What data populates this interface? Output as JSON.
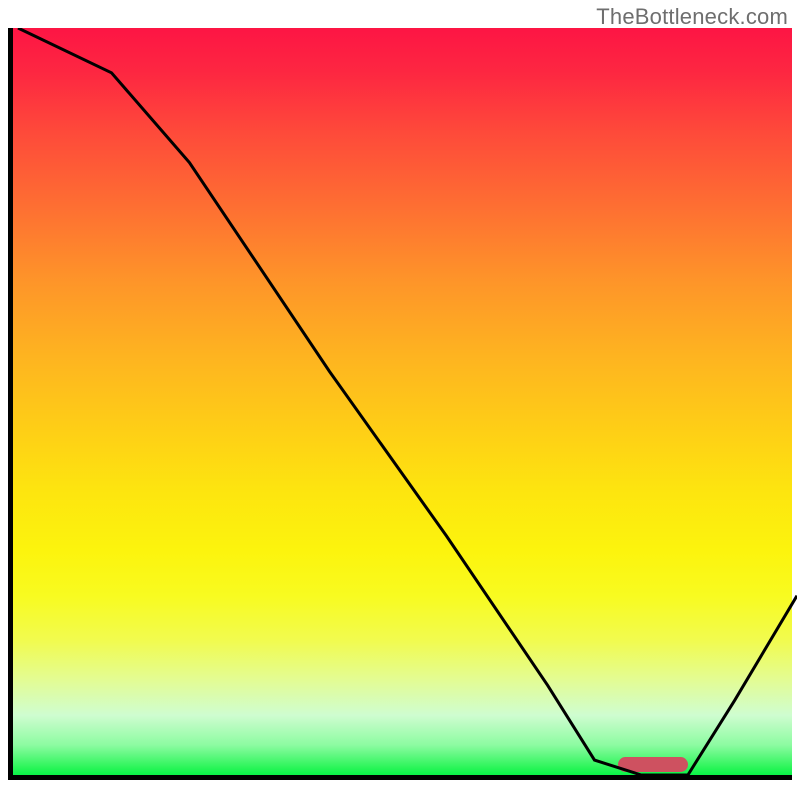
{
  "watermark": "TheBottleneck.com",
  "chart_data": {
    "type": "line",
    "title": "",
    "xlabel": "",
    "ylabel": "",
    "xlim": [
      0,
      100
    ],
    "ylim": [
      0,
      100
    ],
    "background": "traffic-light-gradient",
    "series": [
      {
        "name": "bottleneck-curve",
        "x": [
          0,
          12,
          22,
          40,
          55,
          68,
          74,
          80,
          86,
          92,
          100
        ],
        "values": [
          100,
          94,
          82,
          54,
          32,
          12,
          2,
          0,
          0,
          10,
          24
        ]
      }
    ],
    "optimum_band": {
      "x_start": 77,
      "x_end": 86
    }
  },
  "colors": {
    "axis": "#000000",
    "curve": "#000000",
    "marker": "#ce5160"
  }
}
